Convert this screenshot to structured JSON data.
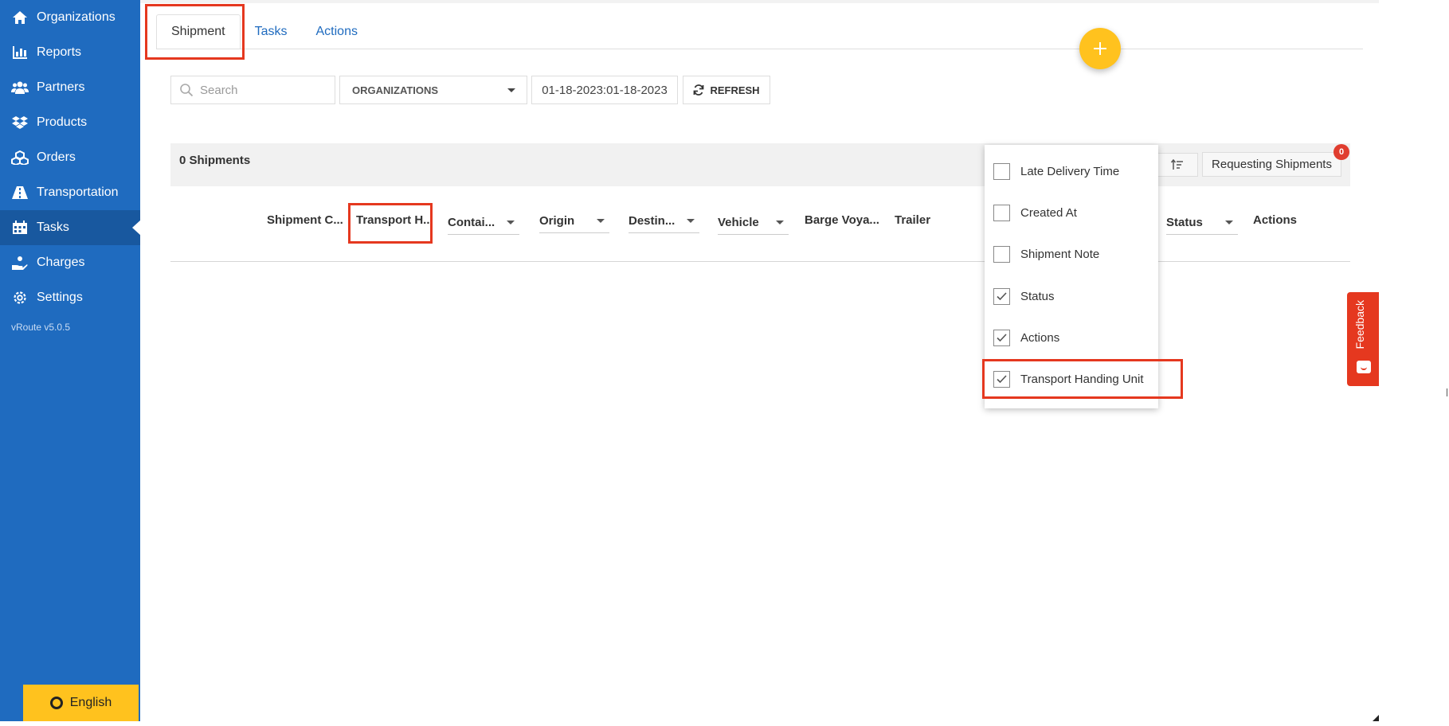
{
  "sidebar": {
    "items": [
      {
        "label": "Organizations",
        "icon": "home-icon"
      },
      {
        "label": "Reports",
        "icon": "bar-chart-icon"
      },
      {
        "label": "Partners",
        "icon": "users-icon"
      },
      {
        "label": "Products",
        "icon": "dropbox-icon"
      },
      {
        "label": "Orders",
        "icon": "cubes-icon"
      },
      {
        "label": "Transportation",
        "icon": "road-icon"
      },
      {
        "label": "Tasks",
        "icon": "calendar-icon"
      },
      {
        "label": "Charges",
        "icon": "hand-coin-icon"
      },
      {
        "label": "Settings",
        "icon": "gear-icon"
      }
    ],
    "active": "Tasks",
    "version": "vRoute v5.0.5",
    "language_label": "English"
  },
  "tabs": [
    {
      "label": "Shipment",
      "active": true
    },
    {
      "label": "Tasks",
      "active": false
    },
    {
      "label": "Actions",
      "active": false
    }
  ],
  "toolbar": {
    "search_placeholder": "Search",
    "organizations_label": "ORGANIZATIONS",
    "date_range": "01-18-2023:01-18-2023",
    "refresh_label": "REFRESH"
  },
  "grid": {
    "count_label": "0 Shipments",
    "requesting_label": "Requesting Shipments",
    "badge_count": "0",
    "columns": [
      "Shipment C...",
      "Transport H...",
      "Contai...",
      "Origin",
      "Destin...",
      "Vehicle",
      "Barge Voya...",
      "Trailer",
      "Status",
      "Actions"
    ]
  },
  "column_menu": {
    "items": [
      {
        "label": "Late Delivery Time",
        "checked": false
      },
      {
        "label": "Created At",
        "checked": false
      },
      {
        "label": "Shipment Note",
        "checked": false
      },
      {
        "label": "Status",
        "checked": true
      },
      {
        "label": "Actions",
        "checked": true
      },
      {
        "label": "Transport Handing Unit",
        "checked": true
      }
    ]
  },
  "feedback_label": "Feedback",
  "colors": {
    "sidebar": "#1f6bbf",
    "accent_yellow": "#ffc21e",
    "highlight_red": "#e5381f",
    "link_blue": "#1f6bbf"
  }
}
